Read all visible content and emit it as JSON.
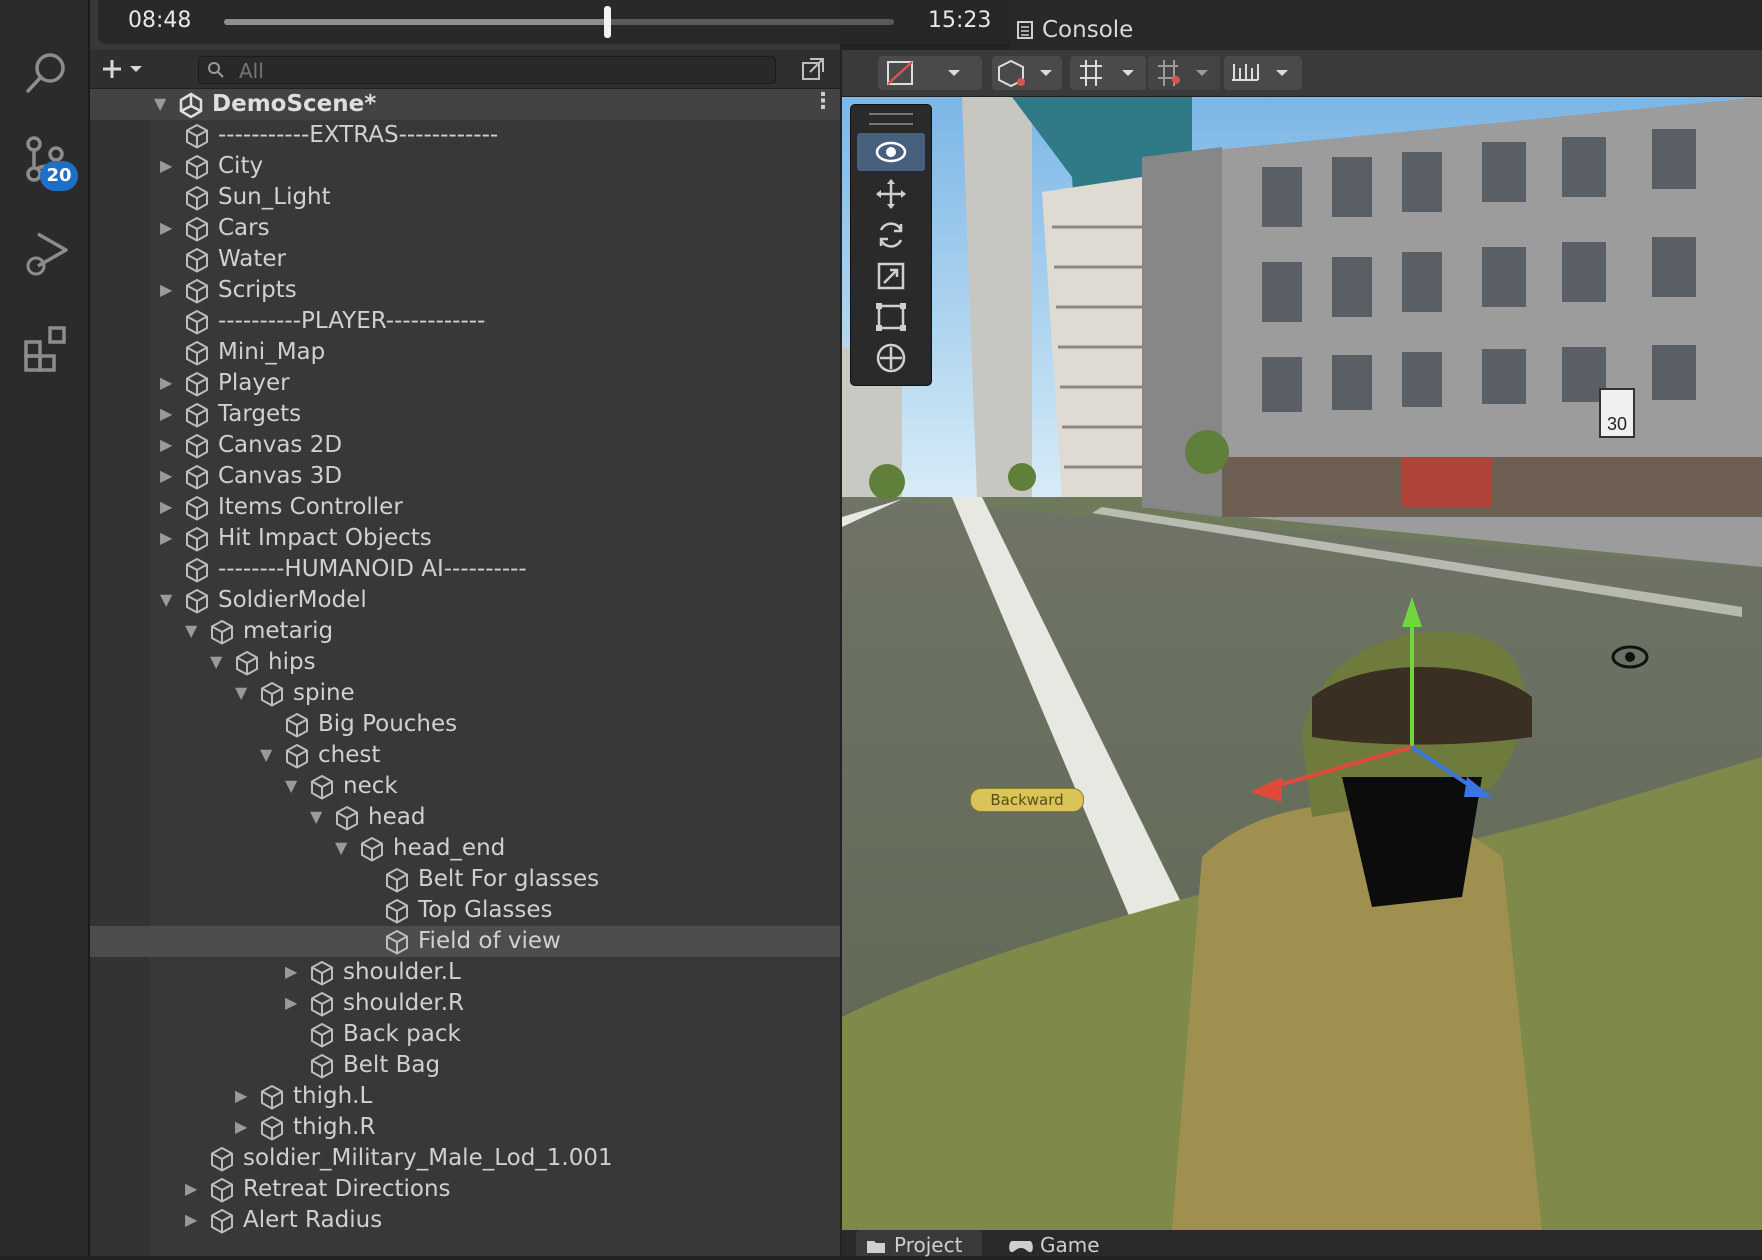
{
  "player": {
    "current_time": "08:48",
    "total_time": "15:23",
    "progress": 0.571
  },
  "activity_bar": {
    "source_control_badge": "20"
  },
  "hierarchy": {
    "search_placeholder": "All",
    "scene_name": "DemoScene*",
    "items": [
      {
        "label": "-----------EXTRAS------------",
        "depth": 0,
        "expand": "none"
      },
      {
        "label": "City",
        "depth": 0,
        "expand": "collapsed"
      },
      {
        "label": "Sun_Light",
        "depth": 0,
        "expand": "none"
      },
      {
        "label": "Cars",
        "depth": 0,
        "expand": "collapsed"
      },
      {
        "label": "Water",
        "depth": 0,
        "expand": "none"
      },
      {
        "label": "Scripts",
        "depth": 0,
        "expand": "collapsed"
      },
      {
        "label": "----------PLAYER------------",
        "depth": 0,
        "expand": "none"
      },
      {
        "label": "Mini_Map",
        "depth": 0,
        "expand": "none"
      },
      {
        "label": "Player",
        "depth": 0,
        "expand": "collapsed"
      },
      {
        "label": "Targets",
        "depth": 0,
        "expand": "collapsed"
      },
      {
        "label": "Canvas 2D",
        "depth": 0,
        "expand": "collapsed"
      },
      {
        "label": "Canvas 3D",
        "depth": 0,
        "expand": "collapsed"
      },
      {
        "label": "Items Controller",
        "depth": 0,
        "expand": "collapsed"
      },
      {
        "label": "Hit Impact Objects",
        "depth": 0,
        "expand": "collapsed"
      },
      {
        "label": "--------HUMANOID AI----------",
        "depth": 0,
        "expand": "none"
      },
      {
        "label": "SoldierModel",
        "depth": 0,
        "expand": "expanded"
      },
      {
        "label": "metarig",
        "depth": 1,
        "expand": "expanded"
      },
      {
        "label": "hips",
        "depth": 2,
        "expand": "expanded"
      },
      {
        "label": "spine",
        "depth": 3,
        "expand": "expanded"
      },
      {
        "label": "Big Pouches",
        "depth": 4,
        "expand": "none"
      },
      {
        "label": "chest",
        "depth": 4,
        "expand": "expanded"
      },
      {
        "label": "neck",
        "depth": 5,
        "expand": "expanded"
      },
      {
        "label": "head",
        "depth": 6,
        "expand": "expanded"
      },
      {
        "label": "head_end",
        "depth": 7,
        "expand": "expanded"
      },
      {
        "label": "Belt For glasses",
        "depth": 8,
        "expand": "none"
      },
      {
        "label": "Top Glasses",
        "depth": 8,
        "expand": "none"
      },
      {
        "label": "Field of view",
        "depth": 8,
        "expand": "none",
        "selected": true
      },
      {
        "label": "shoulder.L",
        "depth": 5,
        "expand": "collapsed"
      },
      {
        "label": "shoulder.R",
        "depth": 5,
        "expand": "collapsed"
      },
      {
        "label": "Back pack",
        "depth": 5,
        "expand": "none"
      },
      {
        "label": "Belt Bag",
        "depth": 5,
        "expand": "none"
      },
      {
        "label": "thigh.L",
        "depth": 3,
        "expand": "collapsed"
      },
      {
        "label": "thigh.R",
        "depth": 3,
        "expand": "collapsed"
      },
      {
        "label": "soldier_Military_Male_Lod_1.001",
        "depth": 1,
        "expand": "none"
      },
      {
        "label": "Retreat Directions",
        "depth": 1,
        "expand": "collapsed"
      },
      {
        "label": "Alert Radius",
        "depth": 1,
        "expand": "collapsed"
      }
    ]
  },
  "scene_view": {
    "console_tab": "Console",
    "speed_sign": "30",
    "waypoint_label": "Backward"
  },
  "bottom_tabs": {
    "project": "Project",
    "game": "Game"
  }
}
